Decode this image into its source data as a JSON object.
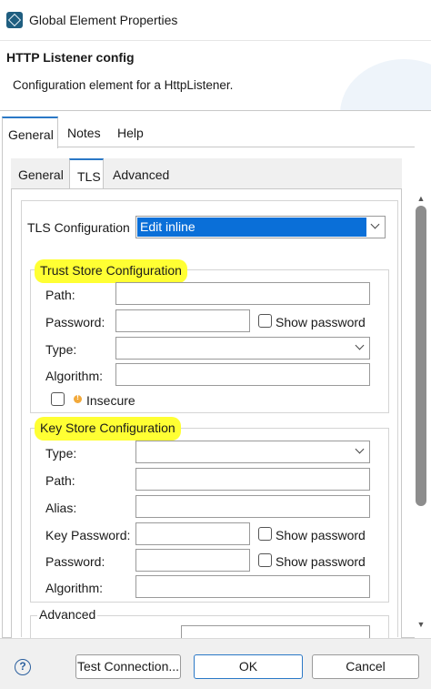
{
  "window": {
    "title": "Global Element Properties",
    "icon": "mule-app-icon"
  },
  "header": {
    "title": "HTTP Listener config",
    "description": "Configuration element for a HttpListener."
  },
  "outer_tabs": [
    {
      "label": "General",
      "active": true
    },
    {
      "label": "Notes",
      "active": false
    },
    {
      "label": "Help",
      "active": false
    }
  ],
  "inner_tabs": [
    {
      "label": "General",
      "active": false
    },
    {
      "label": "TLS",
      "active": true
    },
    {
      "label": "Advanced",
      "active": false
    }
  ],
  "tls": {
    "label": "TLS Configuration",
    "value": "Edit inline"
  },
  "trust_store": {
    "title": "Trust Store Configuration",
    "path_label": "Path:",
    "password_label": "Password:",
    "show_password": "Show password",
    "type_label": "Type:",
    "algorithm_label": "Algorithm:",
    "insecure_label": "Insecure"
  },
  "key_store": {
    "title": "Key Store Configuration",
    "type_label": "Type:",
    "path_label": "Path:",
    "alias_label": "Alias:",
    "key_password_label": "Key Password:",
    "show_password_1": "Show password",
    "password_label": "Password:",
    "show_password_2": "Show password",
    "algorithm_label": "Algorithm:"
  },
  "advanced": {
    "title": "Advanced"
  },
  "footer": {
    "help": "?",
    "test_connection": "Test Connection...",
    "ok": "OK",
    "cancel": "Cancel"
  },
  "colors": {
    "accent": "#2a78c6",
    "selection": "#0a6fd8",
    "highlight": "#ffff33"
  }
}
